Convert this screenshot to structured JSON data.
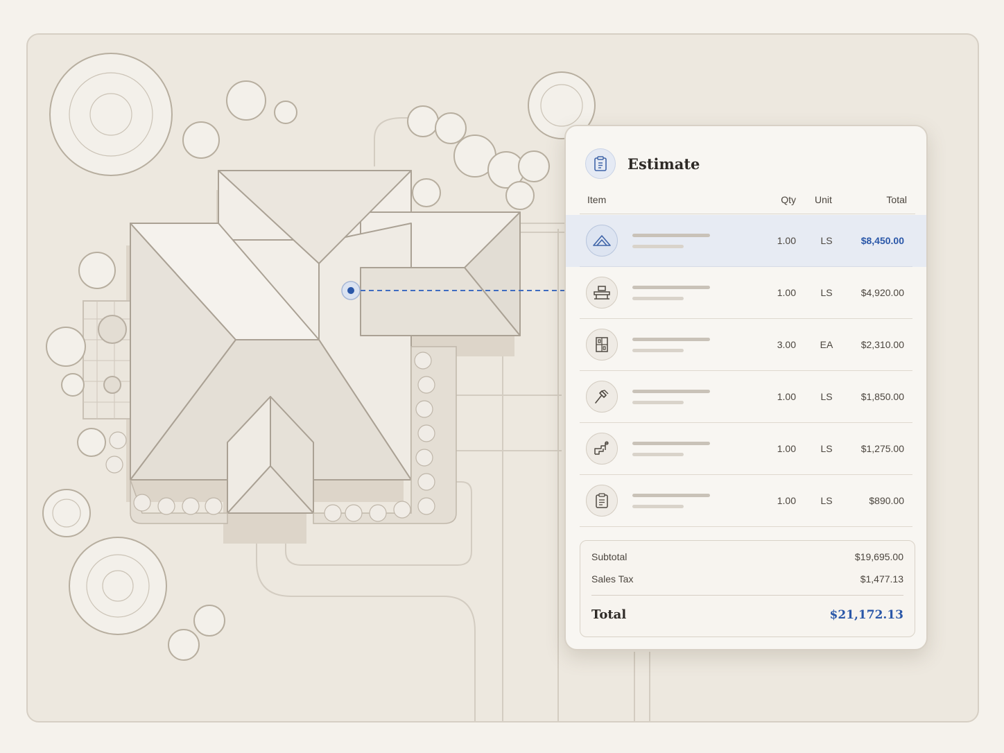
{
  "estimate": {
    "title": "Estimate",
    "columns": {
      "item": "Item",
      "qty": "Qty",
      "unit": "Unit",
      "total": "Total"
    },
    "rows": [
      {
        "icon": "roof-icon",
        "qty": "1.00",
        "unit": "LS",
        "total": "$8,450.00",
        "selected": true
      },
      {
        "icon": "framing-icon",
        "qty": "1.00",
        "unit": "LS",
        "total": "$4,920.00",
        "selected": false
      },
      {
        "icon": "window-icon",
        "qty": "3.00",
        "unit": "EA",
        "total": "$2,310.00",
        "selected": false
      },
      {
        "icon": "hammer-icon",
        "qty": "1.00",
        "unit": "LS",
        "total": "$1,850.00",
        "selected": false
      },
      {
        "icon": "plumbing-icon",
        "qty": "1.00",
        "unit": "LS",
        "total": "$1,275.00",
        "selected": false
      },
      {
        "icon": "clipboard-icon",
        "qty": "1.00",
        "unit": "LS",
        "total": "$890.00",
        "selected": false
      }
    ],
    "summary": {
      "subtotal_label": "Subtotal",
      "subtotal_value": "$19,695.00",
      "tax_label": "Sales Tax",
      "tax_value": "$1,477.13",
      "total_label": "Total",
      "total_value": "$21,172.13"
    }
  },
  "colors": {
    "accent": "#2a57a8",
    "background": "#f5f2ec",
    "panel": "#f8f6f2"
  }
}
